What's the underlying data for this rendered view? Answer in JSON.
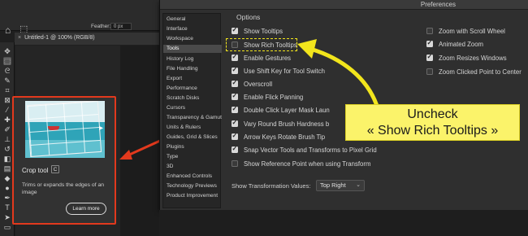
{
  "window": {
    "title": "Preferences"
  },
  "photoshop": {
    "feather_label": "Feather:",
    "feather_value": "0 px",
    "document_tab": "Untitled-1 @ 100% (RGB/8)"
  },
  "tooltip": {
    "title": "Crop tool",
    "shortcut": "C",
    "description": "Trims or expands the edges of an image",
    "learn_more": "Learn more"
  },
  "sidebar": {
    "items": [
      {
        "label": "General"
      },
      {
        "label": "Interface"
      },
      {
        "label": "Workspace"
      },
      {
        "label": "Tools",
        "selected": true
      },
      {
        "label": "History Log"
      },
      {
        "label": "File Handling"
      },
      {
        "label": "Export"
      },
      {
        "label": "Performance"
      },
      {
        "label": "Scratch Disks"
      },
      {
        "label": "Cursors"
      },
      {
        "label": "Transparency & Gamut"
      },
      {
        "label": "Units & Rulers"
      },
      {
        "label": "Guides, Grid & Slices"
      },
      {
        "label": "Plugins"
      },
      {
        "label": "Type"
      },
      {
        "label": "3D"
      },
      {
        "label": "Enhanced Controls"
      },
      {
        "label": "Technology Previews"
      },
      {
        "label": "Product Improvement"
      }
    ]
  },
  "options": {
    "heading": "Options",
    "left": [
      {
        "label": "Show Tooltips",
        "checked": true
      },
      {
        "label": "Show Rich Tooltips",
        "checked": false
      },
      {
        "label": "Enable Gestures",
        "checked": true
      },
      {
        "label": "Use Shift Key for Tool Switch",
        "checked": true
      },
      {
        "label": "Overscroll",
        "checked": true
      },
      {
        "label": "Enable Flick Panning",
        "checked": true
      },
      {
        "label": "Double Click Layer Mask Laun",
        "checked": true
      },
      {
        "label": "Vary Round Brush Hardness b",
        "checked": true
      },
      {
        "label": "Arrow Keys Rotate Brush Tip",
        "checked": true
      },
      {
        "label": "Snap Vector Tools and Transforms to Pixel Grid",
        "checked": true
      },
      {
        "label": "Show Reference Point when using Transform",
        "checked": false
      }
    ],
    "right": [
      {
        "label": "Zoom with Scroll Wheel",
        "checked": false
      },
      {
        "label": "Animated Zoom",
        "checked": true
      },
      {
        "label": "Zoom Resizes Windows",
        "checked": true
      },
      {
        "label": "Zoom Clicked Point to Center",
        "checked": false
      }
    ],
    "transformation_label": "Show Transformation Values:",
    "transformation_value": "Top Right"
  },
  "annotation": {
    "line1": "Uncheck",
    "line2": "« Show Rich Tooltips »",
    "callout_color": "#fbf36a",
    "arrow_color": "#f2e51c",
    "red_arrow_color": "#e2391d"
  }
}
